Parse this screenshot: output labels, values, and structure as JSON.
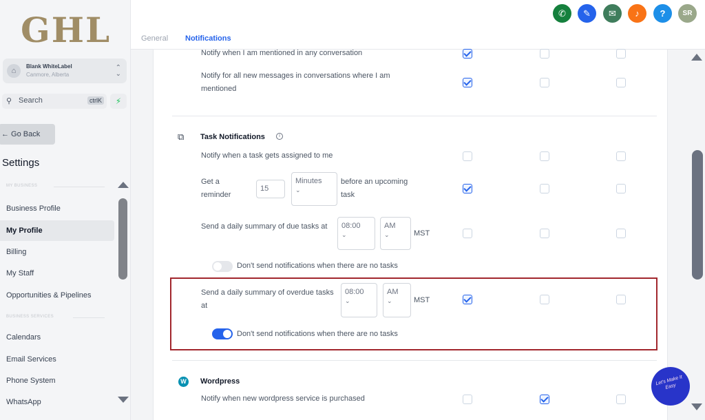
{
  "sidebar": {
    "logo": "GHL",
    "account_name": "Blank WhiteLabel",
    "account_location": "Canmore, Alberta",
    "search_placeholder": "Search",
    "search_shortcut": "ctrlK",
    "go_back": "← Go Back",
    "title": "Settings",
    "section_business": "MY BUSINESS",
    "section_services": "BUSINESS SERVICES",
    "items": [
      {
        "label": "Business Profile"
      },
      {
        "label": "My Profile"
      },
      {
        "label": "Billing"
      },
      {
        "label": "My Staff"
      },
      {
        "label": "Opportunities & Pipelines"
      },
      {
        "label": "Calendars"
      },
      {
        "label": "Email Services"
      },
      {
        "label": "Phone System"
      },
      {
        "label": "WhatsApp"
      }
    ],
    "active_item": "My Profile"
  },
  "header": {
    "tabs": [
      {
        "label": "General"
      },
      {
        "label": "Notifications"
      }
    ],
    "active_tab": "Notifications",
    "user_initials": "SR",
    "icons": [
      {
        "name": "phone-icon",
        "color": "#15803d"
      },
      {
        "name": "magic-wand-icon",
        "color": "#2563eb"
      },
      {
        "name": "megaphone-icon",
        "color": "#3f7d5c"
      },
      {
        "name": "bell-icon",
        "color": "#f97316"
      },
      {
        "name": "help-icon",
        "color": "#1d8fe8"
      },
      {
        "name": "avatar-icon",
        "color": "#9aa88a"
      }
    ]
  },
  "notifications": {
    "conversation": {
      "rows": [
        {
          "text": "Notify when I am mentioned in any conversation",
          "checks": [
            true,
            false,
            false
          ]
        },
        {
          "text": "Notify for all new messages in conversations where I am mentioned",
          "checks": [
            true,
            false,
            false
          ]
        }
      ]
    },
    "task": {
      "title": "Task Notifications",
      "assigned": {
        "text": "Notify when a task gets assigned to me",
        "checks": [
          false,
          false,
          false
        ]
      },
      "reminder": {
        "label": "Get a reminder",
        "value": "15",
        "unit": "Minutes",
        "suffix": "before an upcoming task",
        "checks": [
          true,
          false,
          false
        ]
      },
      "due_summary": {
        "label": "Send a daily summary of due tasks at",
        "time": "08:00",
        "ampm": "AM",
        "tz": "MST",
        "checks": [
          false,
          false,
          false
        ],
        "toggle_label": "Don't send notifications when there are no tasks",
        "toggle_on": false
      },
      "overdue_summary": {
        "label": "Send a daily summary of overdue tasks at",
        "time": "08:00",
        "ampm": "AM",
        "tz": "MST",
        "checks": [
          true,
          false,
          false
        ],
        "toggle_label": "Don't send notifications when there are no tasks",
        "toggle_on": true
      }
    },
    "wordpress": {
      "title": "Wordpress",
      "row": {
        "text": "Notify when new wordpress service is purchased",
        "checks": [
          false,
          true,
          false
        ]
      }
    }
  },
  "watermark": "Let's Make It Easy",
  "colors": {
    "accent": "#2563eb",
    "highlight": "#a1252c",
    "logo": "#a08d66"
  }
}
